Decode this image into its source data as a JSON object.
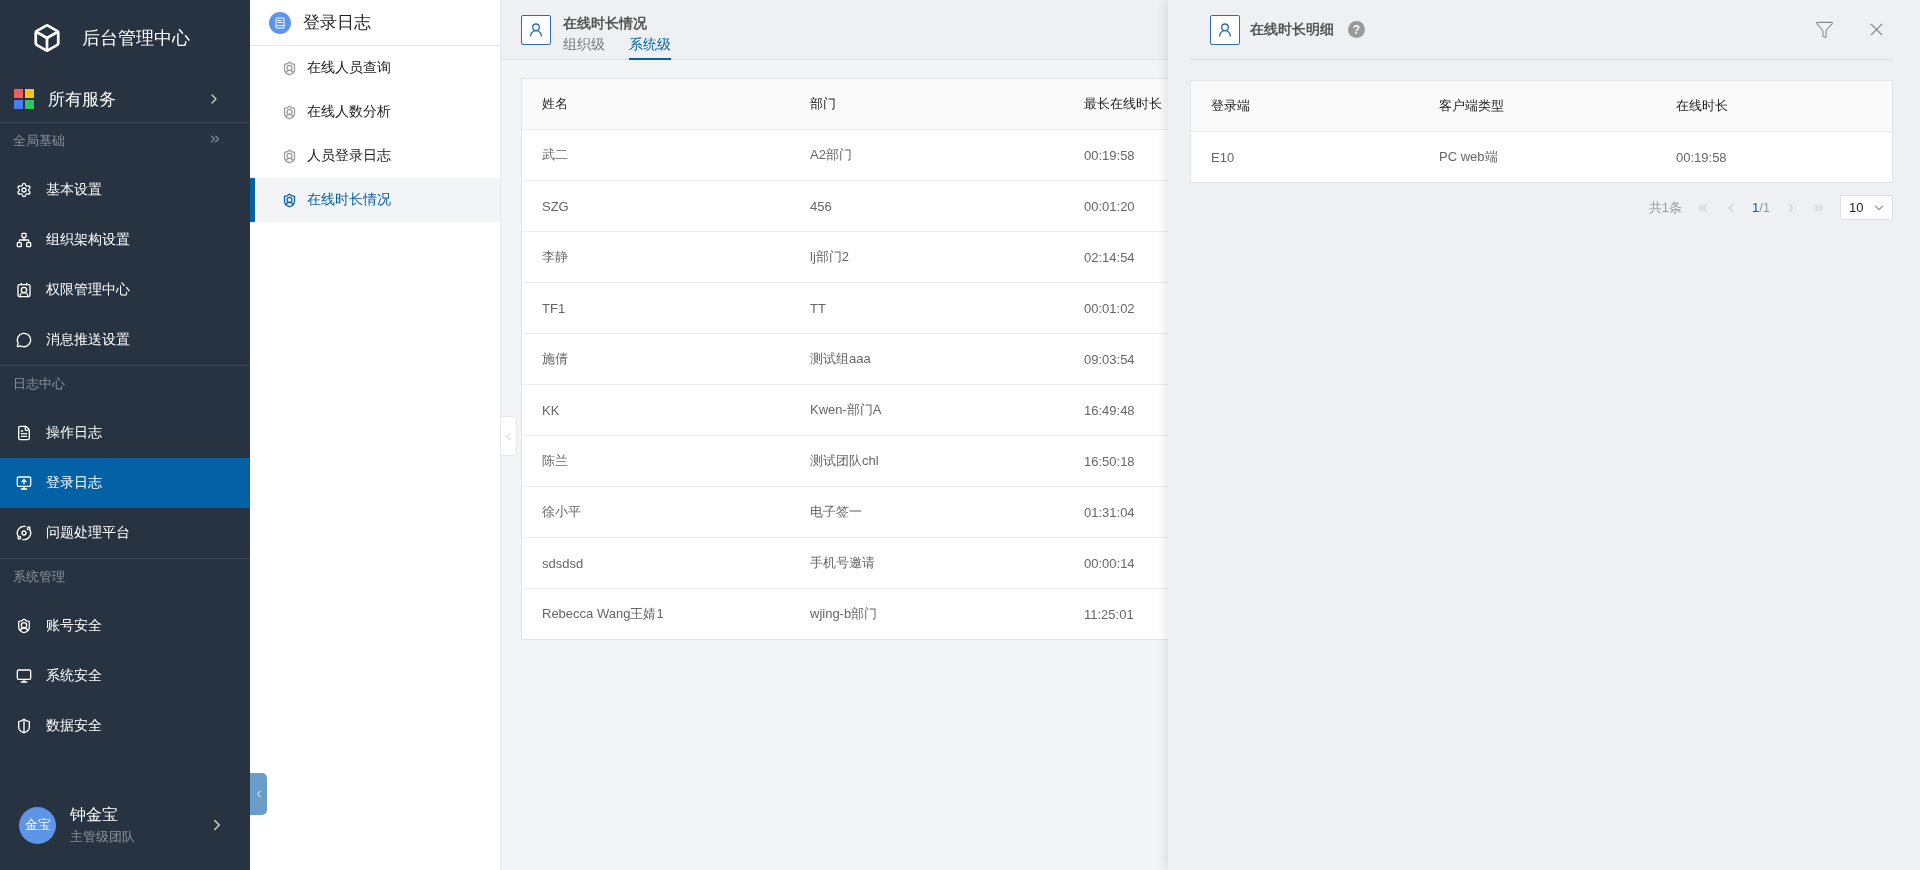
{
  "brand": {
    "title": "后台管理中心"
  },
  "services": {
    "label": "所有服务"
  },
  "nav_groups": [
    {
      "title": "全局基础",
      "items": [
        {
          "label": "基本设置",
          "selected": false
        },
        {
          "label": "组织架构设置",
          "selected": false
        },
        {
          "label": "权限管理中心",
          "selected": false
        },
        {
          "label": "消息推送设置",
          "selected": false
        }
      ]
    },
    {
      "title": "日志中心",
      "items": [
        {
          "label": "操作日志",
          "selected": false
        },
        {
          "label": "登录日志",
          "selected": true
        },
        {
          "label": "问题处理平台",
          "selected": false
        }
      ]
    },
    {
      "title": "系统管理",
      "items": [
        {
          "label": "账号安全",
          "selected": false
        },
        {
          "label": "系统安全",
          "selected": false
        },
        {
          "label": "数据安全",
          "selected": false
        }
      ]
    }
  ],
  "user": {
    "avatar": "金宝",
    "name": "钟金宝",
    "team": "主管级团队"
  },
  "submenu": {
    "title": "登录日志",
    "items": [
      {
        "label": "在线人员查询",
        "selected": false
      },
      {
        "label": "在线人数分析",
        "selected": false
      },
      {
        "label": "人员登录日志",
        "selected": false
      },
      {
        "label": "在线时长情况",
        "selected": true
      }
    ]
  },
  "main": {
    "title": "在线时长情况",
    "tabs": [
      {
        "label": "组织级",
        "selected": false
      },
      {
        "label": "系统级",
        "selected": true
      }
    ],
    "table": {
      "columns": [
        "姓名",
        "部门",
        "最长在线时长"
      ],
      "rows": [
        [
          "武二",
          "A2部门",
          "00:19:58"
        ],
        [
          "SZG",
          "456",
          "00:01:20"
        ],
        [
          "李静",
          "lj部门2",
          "02:14:54"
        ],
        [
          "TF1",
          "TT",
          "00:01:02"
        ],
        [
          "施倩",
          "测试组aaa",
          "09:03:54"
        ],
        [
          "KK",
          "Kwen-部门A",
          "16:49:48"
        ],
        [
          "陈兰",
          "测试团队chl",
          "16:50:18"
        ],
        [
          "徐小平",
          "电子签一",
          "01:31:04"
        ],
        [
          "sdsdsd",
          "手机号邀请",
          "00:00:14"
        ],
        [
          "Rebecca Wang王婧1",
          "wjing-b部门",
          "11:25:01"
        ]
      ]
    }
  },
  "detail_panel": {
    "title": "在线时长明细",
    "help": "?",
    "table": {
      "columns": [
        "登录端",
        "客户端类型",
        "在线时长"
      ],
      "rows": [
        [
          "E10",
          "PC web端",
          "00:19:58"
        ]
      ]
    },
    "pagination": {
      "total": "共1条",
      "page": "1",
      "pages": "/1",
      "page_size": "10"
    }
  }
}
